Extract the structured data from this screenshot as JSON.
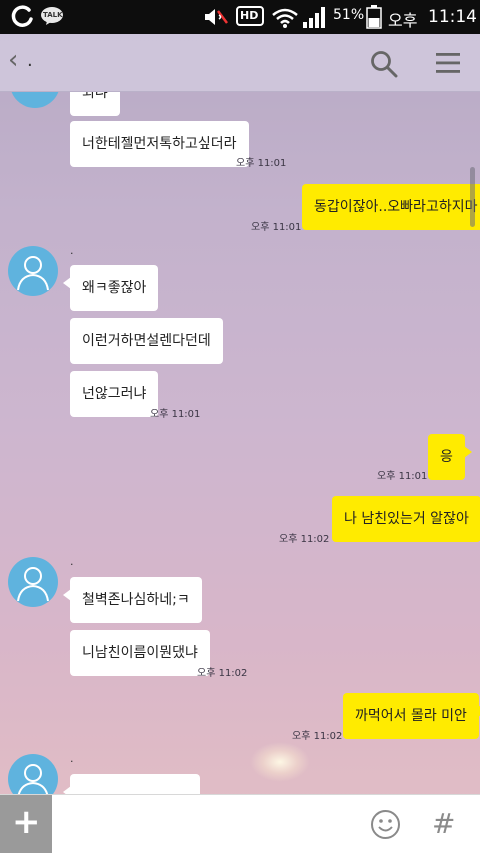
{
  "status_bar": {
    "battery_percent": "51%",
    "ampm": "오후",
    "time": "11:14",
    "kakao_badge": "TALK",
    "hd_badge": "HD",
    "icons": [
      "carrier-o-icon",
      "kakaotalk-icon",
      "speaker-muted-icon",
      "hd-voice-icon",
      "wifi-icon",
      "signal-icon",
      "battery-icon"
    ]
  },
  "top_bar": {
    "back_glyph": "‹",
    "chat_title": ".",
    "icons": [
      "back-icon",
      "search-icon",
      "menu-icon"
    ]
  },
  "messages": [
    {
      "side": "in",
      "text": "되냐",
      "time": ""
    },
    {
      "side": "in",
      "text": "너한테젤먼저톡하고싶더라",
      "time": "오후 11:01"
    },
    {
      "side": "out",
      "text": "동갑이잖아..오빠라고하지마",
      "time": "오후 11:01"
    },
    {
      "side": "in",
      "sender": ".",
      "text": "왜ㅋ좋잖아",
      "time": ""
    },
    {
      "side": "in",
      "text": "이런거하면설렌다던데",
      "time": ""
    },
    {
      "side": "in",
      "text": "넌않그러냐",
      "time": "오후 11:01"
    },
    {
      "side": "out",
      "text": "응",
      "time": "오후 11:01"
    },
    {
      "side": "out",
      "text": "나 남친있는거 알잖아",
      "time": "오후 11:02"
    },
    {
      "side": "in",
      "sender": ".",
      "text": "철벽존나심하네;ㅋ",
      "time": ""
    },
    {
      "side": "in",
      "text": "니남친이름이뭔댔냐",
      "time": "오후 11:02"
    },
    {
      "side": "out",
      "text": "까먹어서 몰라 미안",
      "time": "오후 11:02"
    },
    {
      "side": "in",
      "sender": ".",
      "text": "",
      "time": ""
    }
  ],
  "input_bar": {
    "placeholder": "",
    "plus_glyph": "+",
    "hash_glyph": "#",
    "icons": [
      "plus-icon",
      "emoji-icon",
      "hash-icon"
    ]
  },
  "colors": {
    "my_bubble": "#ffeb00",
    "their_bubble": "#ffffff",
    "avatar": "#5fb3de",
    "status_bar": "#0d0d0d"
  }
}
